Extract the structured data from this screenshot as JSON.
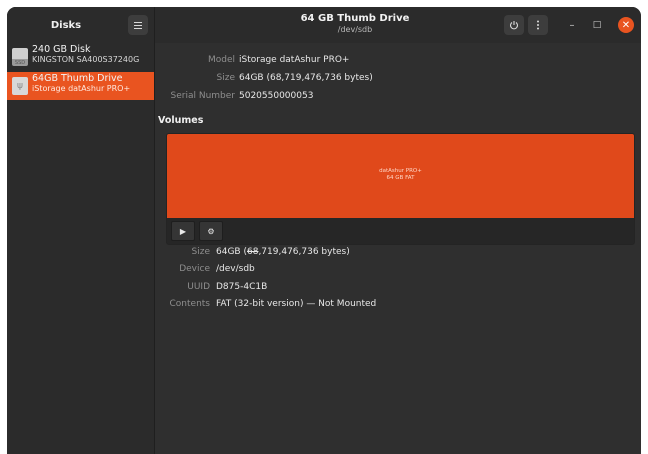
{
  "window": {
    "sidebar_title": "Disks",
    "title": "64 GB Thumb Drive",
    "subtitle": "/dev/sdb",
    "accent_color": "#e95420"
  },
  "header_buttons": {
    "menu_icon": "hamburger-icon",
    "power_icon": "power-icon",
    "more_icon": "vertical-dots-icon",
    "minimize": "–",
    "maximize": "□",
    "close": "✕"
  },
  "drives": [
    {
      "name": "240 GB Disk",
      "model": "KINGSTON SA400S37240G",
      "icon_label": "SSD",
      "icon": "ssd-icon",
      "selected": false
    },
    {
      "name": "64GB Thumb Drive",
      "model": "iStorage datAshur PRO+",
      "icon_label": "ψ",
      "icon": "usb-drive-icon",
      "selected": true
    }
  ],
  "drive_info": {
    "model_label": "Model",
    "model_value": "iStorage datAshur PRO+",
    "size_label": "Size",
    "size_value": "64GB (68,719,476,736 bytes)",
    "serial_label": "Serial Number",
    "serial_value": "5020550000053"
  },
  "volumes": {
    "heading": "Volumes",
    "bar_line1": "datAshur PRO+",
    "bar_line2": "64 GB FAT",
    "bar_color": "#e0491b",
    "mount_button": "▶",
    "settings_button": "⚙"
  },
  "volume_info": {
    "size_label": "Size",
    "size_value_prefix": "64GB (",
    "size_value_strike": "68",
    "size_value_suffix": ",719,476,736 bytes)",
    "device_label": "Device",
    "device_value": "/dev/sdb",
    "uuid_label": "UUID",
    "uuid_value": "D875-4C1B",
    "contents_label": "Contents",
    "contents_value": "FAT (32-bit version) — Not Mounted"
  }
}
